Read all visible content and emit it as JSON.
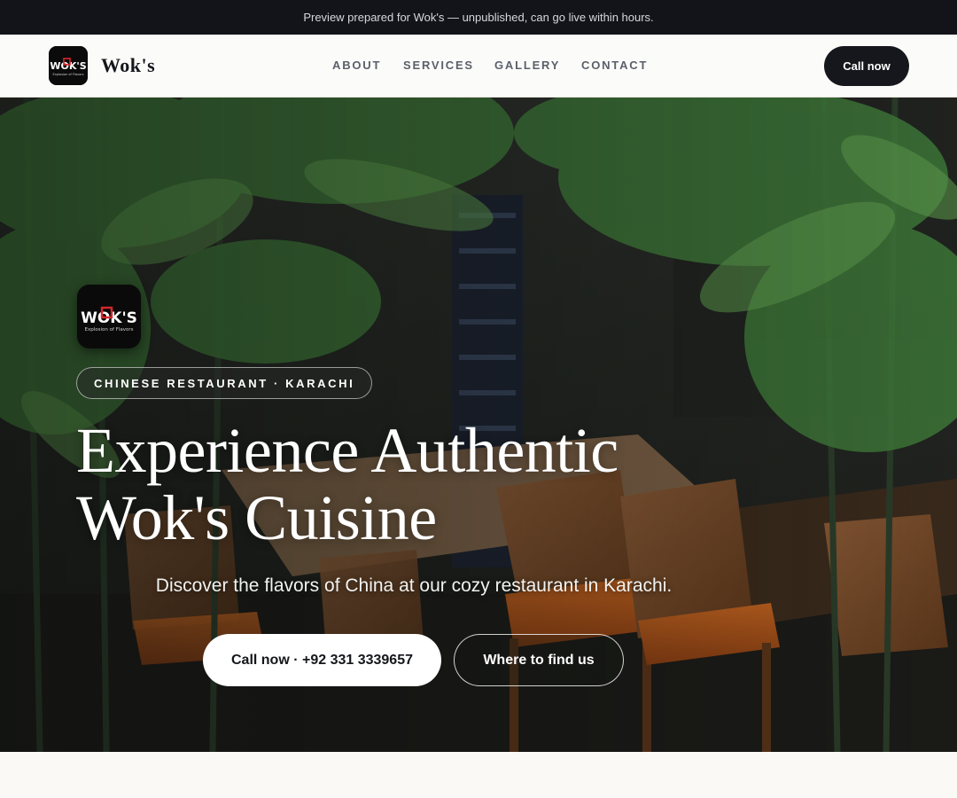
{
  "banner": {
    "text": "Preview prepared for Wok's — unpublished, can go live within hours."
  },
  "header": {
    "brand_name": "Wok's",
    "logo_text": "WOK'S",
    "logo_tagline": "Explosion of Flavors",
    "nav": [
      {
        "label": "ABOUT"
      },
      {
        "label": "SERVICES"
      },
      {
        "label": "GALLERY"
      },
      {
        "label": "CONTACT"
      }
    ],
    "cta_label": "Call now"
  },
  "hero": {
    "tag": "CHINESE RESTAURANT · KARACHI",
    "title_line1": "Experience Authentic",
    "title_line2": "Wok's Cuisine",
    "subtitle": "Discover the flavors of China at our cozy restaurant in Karachi.",
    "primary_button": "Call now · +92 331 3339657",
    "secondary_button": "Where to find us",
    "background_description": "restaurant-interior-photo",
    "accent_colors": {
      "dark": "#15171c",
      "logo_red": "#d6262b",
      "plant_green": "#3f7a3a",
      "chair_wood": "#7a4a2a",
      "seat_orange": "#b8521c"
    }
  }
}
